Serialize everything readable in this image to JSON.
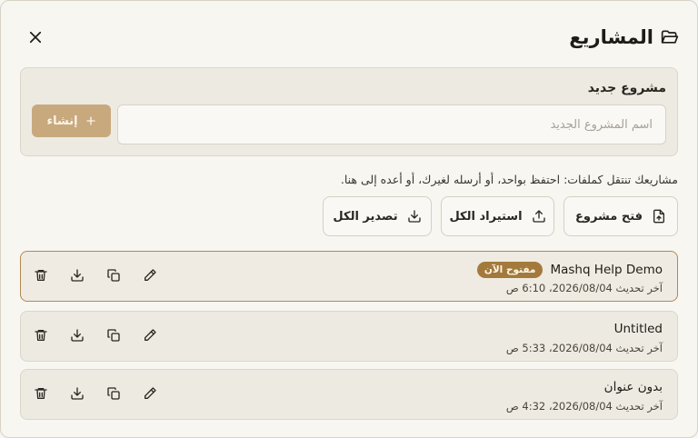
{
  "header": {
    "title": "المشاريع"
  },
  "new_project": {
    "label": "مشروع جديد",
    "input_placeholder": "اسم المشروع الجديد",
    "input_value": "",
    "create_label": "إنشاء"
  },
  "hint": "مشاريعك تنتقل كملفات: احتفظ بواحد، أو أرسله لغيرك، أو أعده إلى هنا.",
  "actions": {
    "open_label": "فتح مشروع",
    "import_label": "استيراد الكل",
    "export_label": "تصدير الكل"
  },
  "projects": [
    {
      "name": "Mashq Help Demo",
      "badge": "مفتوح الآن",
      "updated": "آخر تحديث 2026/08/04، 6:10 ص"
    },
    {
      "name": "Untitled",
      "updated": "آخر تحديث 2026/08/04، 5:33 ص"
    },
    {
      "name": "بدون عنوان",
      "updated": "آخر تحديث 2026/08/04، 4:32 ص"
    }
  ],
  "colors": {
    "accent": "#c8a97d",
    "badge": "#a37a3b",
    "active_border": "#b08a52"
  }
}
